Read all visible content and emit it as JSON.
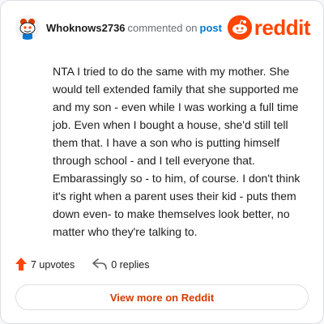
{
  "comment": {
    "username": "Whoknows2736",
    "action_text": "commented on",
    "target_text": "post",
    "body": "NTA I tried to do the same with my mother. She would tell extended family that she supported me and my son - even while I was working a full time job. Even when I bought a house, she'd still tell them that. I have a son who is putting himself through school - and I tell everyone that. Embarassingly so - to him, of course. I don't think it's right when a parent uses their kid - puts them down even- to make themselves look better, no matter who they're talking to."
  },
  "brand": {
    "logo_text": "reddit",
    "color": "#ff4500"
  },
  "actions": {
    "upvotes_label": "7 upvotes",
    "replies_label": "0 replies"
  },
  "footer": {
    "view_more_label": "View more on Reddit"
  },
  "icons": {
    "avatar": "snoo-avatar-icon",
    "logo": "reddit-logo-icon",
    "upvote": "upvote-arrow-icon",
    "reply": "reply-arrow-icon"
  }
}
